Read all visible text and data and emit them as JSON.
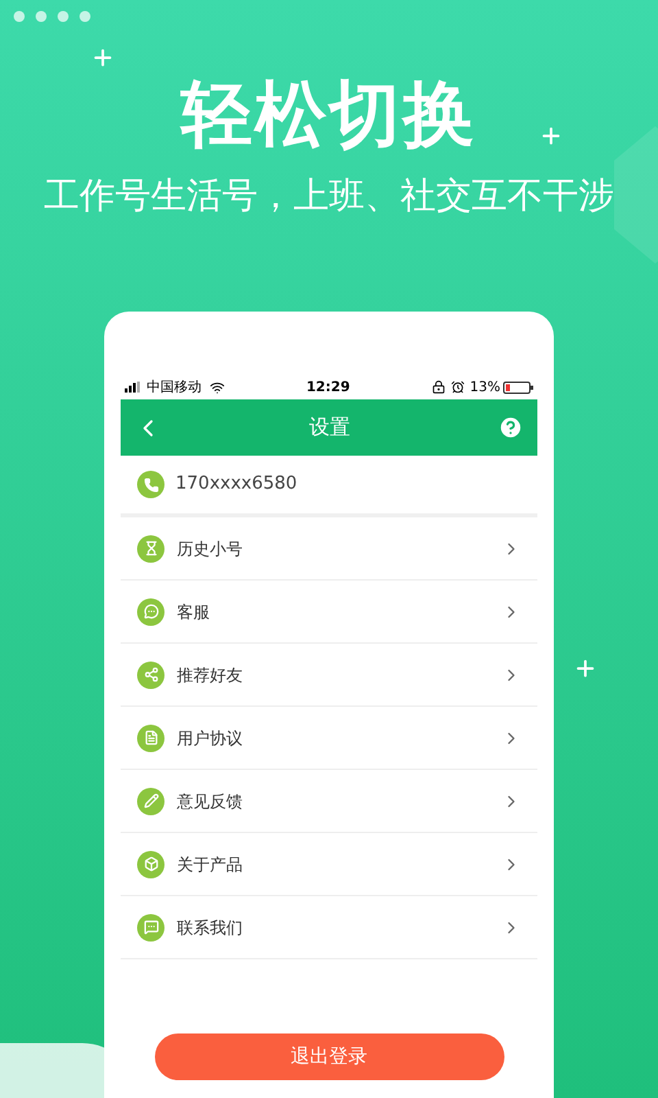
{
  "headline": "轻松切换",
  "subtitle": "工作号生活号，上班、社交互不干涉",
  "status_bar": {
    "carrier": "中国移动",
    "time": "12:29",
    "battery": "13%"
  },
  "nav": {
    "title": "设置"
  },
  "account": {
    "phone": "170xxxx6580"
  },
  "menu_items": [
    {
      "label": "历史小号"
    },
    {
      "label": "客服"
    },
    {
      "label": "推荐好友"
    },
    {
      "label": "用户协议"
    },
    {
      "label": "意见反馈"
    },
    {
      "label": "关于产品"
    },
    {
      "label": "联系我们"
    }
  ],
  "logout_button": "退出登录"
}
